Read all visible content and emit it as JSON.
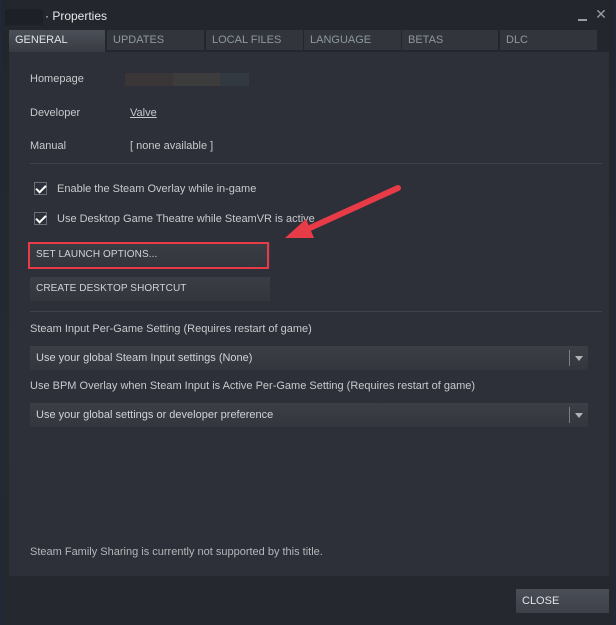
{
  "window": {
    "title": "· Properties",
    "minimize_label": "_",
    "close_glyph": "✕"
  },
  "tabs": [
    {
      "label": "GENERAL",
      "active": true
    },
    {
      "label": "UPDATES",
      "active": false
    },
    {
      "label": "LOCAL FILES",
      "active": false
    },
    {
      "label": "LANGUAGE",
      "active": false
    },
    {
      "label": "BETAS",
      "active": false
    },
    {
      "label": "DLC",
      "active": false
    }
  ],
  "general": {
    "homepage": {
      "label": "Homepage",
      "value_redacted": true
    },
    "developer": {
      "label": "Developer",
      "value": "Valve"
    },
    "manual": {
      "label": "Manual",
      "value": "[ none available ]"
    },
    "checkboxes": [
      {
        "label": "Enable the Steam Overlay while in-game",
        "checked": true
      },
      {
        "label": "Use Desktop Game Theatre while SteamVR is active",
        "checked": true
      }
    ],
    "buttons": {
      "set_launch_options": "SET LAUNCH OPTIONS...",
      "create_desktop_shortcut": "CREATE DESKTOP SHORTCUT"
    },
    "steam_input": {
      "label": "Steam Input Per-Game Setting (Requires restart of game)",
      "selected": "Use your global Steam Input settings (None)"
    },
    "bpm_overlay": {
      "label": "Use BPM Overlay when Steam Input is Active Per-Game Setting (Requires restart of game)",
      "selected": "Use your global settings or developer preference"
    },
    "family_sharing_note": "Steam Family Sharing is currently not supported by this title."
  },
  "footer": {
    "close_label": "CLOSE"
  },
  "annotation": {
    "highlight_color": "#e73c47",
    "target": "set-launch-options-button"
  }
}
